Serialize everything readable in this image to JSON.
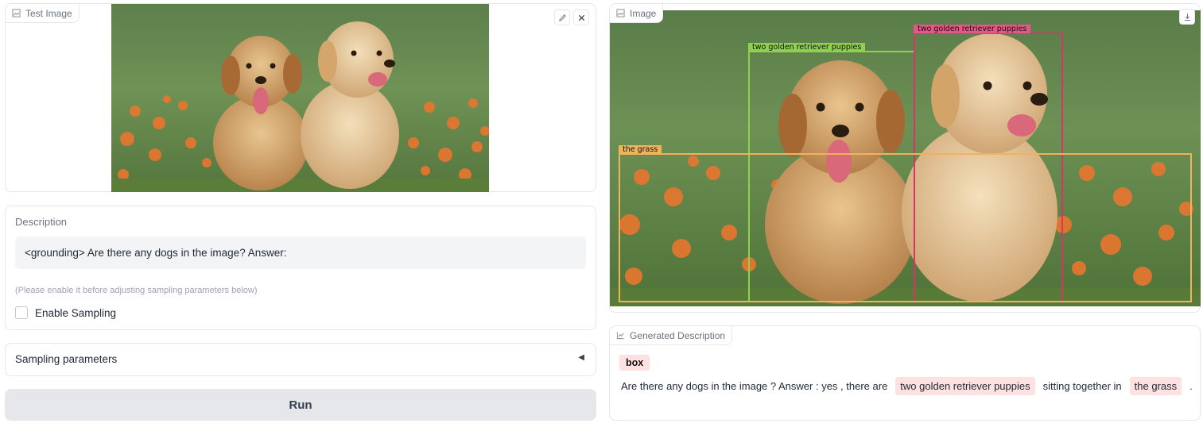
{
  "input_panel": {
    "label": "Test Image"
  },
  "description": {
    "label": "Description",
    "value": "<grounding> Are there any dogs in the image? Answer:",
    "hint": "(Please enable it before adjusting sampling parameters below)"
  },
  "sampling": {
    "checkbox_label": "Enable Sampling",
    "checked": false
  },
  "accordion": {
    "label": "Sampling parameters",
    "caret": "◀"
  },
  "run_button": {
    "label": "Run"
  },
  "output_panel": {
    "label": "Image",
    "boxes": [
      {
        "label": "two golden retriever puppies",
        "color": "#8fd14f"
      },
      {
        "label": "two golden retriever puppies",
        "color": "#d9336a"
      },
      {
        "label": "the grass",
        "color": "#f0b25a"
      }
    ]
  },
  "generated": {
    "label": "Generated Description",
    "tag": "box",
    "segments": [
      {
        "text": "Are there any dogs in the image ? Answer : yes , there are",
        "highlight": false
      },
      {
        "text": "two golden retriever puppies",
        "highlight": true
      },
      {
        "text": "sitting together in",
        "highlight": false
      },
      {
        "text": "the grass",
        "highlight": true
      },
      {
        "text": ".",
        "highlight": false
      }
    ]
  },
  "icons": [
    "image-icon",
    "edit-icon",
    "close-icon",
    "download-icon",
    "chart-icon"
  ]
}
